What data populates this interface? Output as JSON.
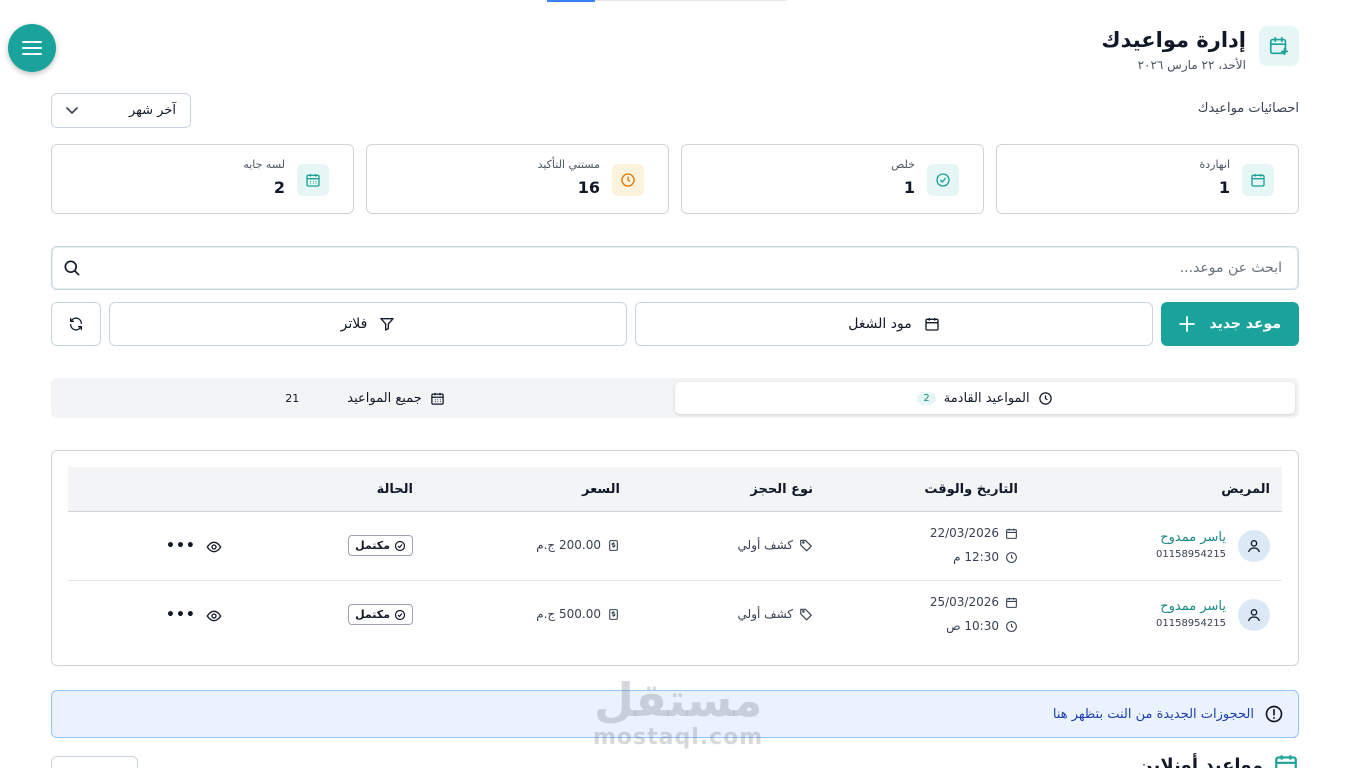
{
  "header": {
    "title": "إدارة مواعيدك",
    "date": "الأحد، ٢٢ مارس ٢٠٢٦"
  },
  "stats": {
    "label": "احصائيات مواعيدك",
    "period_selected": "آخر شهر",
    "cards": [
      {
        "label": "انهاردة",
        "value": "1",
        "icon": "calendar-icon",
        "icon_color": "#1aa39a",
        "icon_bg": "#e6f6f4"
      },
      {
        "label": "خلص",
        "value": "1",
        "icon": "check-circle-icon",
        "icon_color": "#1aa39a",
        "icon_bg": "#e6f6f4"
      },
      {
        "label": "مستني التأكيد",
        "value": "16",
        "icon": "clock-icon",
        "icon_color": "#d97706",
        "icon_bg": "#fdf3dc"
      },
      {
        "label": "لسه جايه",
        "value": "2",
        "icon": "calendar-grid-icon",
        "icon_color": "#1aa39a",
        "icon_bg": "#e6f6f4"
      }
    ]
  },
  "search": {
    "placeholder": "ابحث عن موعد..."
  },
  "actions": {
    "new_appointment": "موعد جديد",
    "work_mode": "مود الشغل",
    "filters": "فلاتر"
  },
  "tabs": [
    {
      "label": "المواعيد القادمة",
      "count": "2"
    },
    {
      "label": "جميع المواعيد",
      "count": "21"
    }
  ],
  "table": {
    "headers": {
      "patient": "المريض",
      "datetime": "التاريخ والوقت",
      "kind": "نوع الحجز",
      "price": "السعر",
      "status": "الحالة"
    },
    "rows": [
      {
        "name": "ياسر ممدوح",
        "phone": "01158954215",
        "date": "22/03/2026",
        "time": "12:30 م",
        "kind": "كشف أولي",
        "price": "200.00 ج.م",
        "status": "مكتمل"
      },
      {
        "name": "ياسر ممدوح",
        "phone": "01158954215",
        "date": "25/03/2026",
        "time": "10:30 ص",
        "kind": "كشف أولي",
        "price": "500.00 ج.م",
        "status": "مكتمل"
      }
    ]
  },
  "notice": {
    "text": "الحجوزات الجديدة من النت بتظهر هنا"
  },
  "online": {
    "title": "مواعيد أونلاين"
  },
  "watermark": {
    "arabic": "مستقل",
    "latin": "mostaql.com"
  },
  "colors": {
    "accent": "#1aa39a",
    "warning": "#d97706",
    "info_bg": "#eaf3fd"
  }
}
